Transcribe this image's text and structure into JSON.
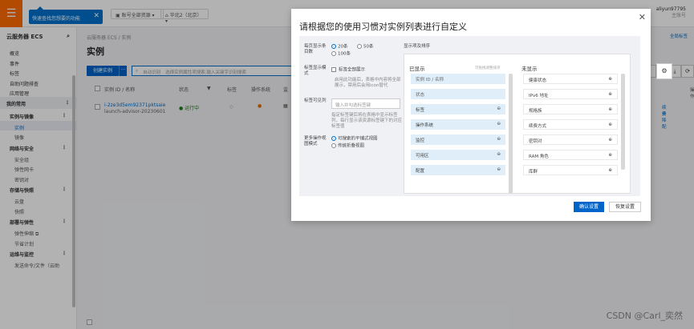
{
  "topbar": {
    "menu_icon": "hamburger-icon",
    "tip_text": "快速查找您想要的功能",
    "resource_group": "账号全部资源",
    "region": "华北2（北京）",
    "user_name": "aliyun97795",
    "user_sub": "主账号"
  },
  "sidebar": {
    "title": "云服务器 ECS",
    "items": [
      "概览",
      "事件",
      "标签",
      "自助问题排查",
      "应用管理"
    ],
    "fav_section": "我的常用",
    "instance_section": "实例与镜像",
    "instance_items": [
      "实例",
      "镜像"
    ],
    "network_section": "网络与安全",
    "network_items": [
      "安全组",
      "弹性网卡",
      "密钥对"
    ],
    "storage_section": "存储与快照",
    "storage_items": [
      "云盘",
      "快照"
    ],
    "deploy_section": "部署与弹性",
    "deploy_items": [
      "弹性伸缩",
      "节省计划"
    ],
    "ops_section": "运维与监控",
    "ops_items": [
      "发送命令/文件（云助"
    ]
  },
  "main": {
    "breadcrumb": "云服务器 ECS / 实例",
    "title": "实例",
    "create_button": "创建实例",
    "more_button": "···",
    "search_filter": "自动识别",
    "search_placeholder": "选择实例属性项搜索,输入关键字识别搜索",
    "columns": [
      "实例 ID / 名称",
      "状态",
      "标签",
      "操作系统",
      "监"
    ],
    "row": {
      "id": "i-2ze3d5em92371pktsaie",
      "name": "launch-advisor-20230601",
      "status": "运行中"
    },
    "right_cols": [
      "续费",
      "升降配"
    ],
    "right_col_header": "操作",
    "extra_link": "全局标签",
    "watermark": "CSDN @Carl_奕然"
  },
  "modal": {
    "title": "请根据您的使用习惯对实例列表进行自定义",
    "page_size_label": "每页显示条目数",
    "page_sizes": [
      "20条",
      "50条",
      "100条"
    ],
    "page_size_selected": "20条",
    "tag_mode_label": "标签显示模式",
    "tag_mode_option": "标签全部展示",
    "tag_mode_hint": "启用此功能后，表格中内容将全部展示，禁用后会用icon替代",
    "tag_column_label": "标签可见列",
    "tag_input_placeholder": "输入并勾选标签键",
    "tag_column_hint": "指定标签键后将在表格中显示标签列，每行显示该资源标签键下的对应标签值",
    "ops_mode_label": "更多操作视图模式",
    "ops_mode_options": [
      "可搜索的平铺式视图",
      "传统折叠视图"
    ],
    "ops_mode_selected": "可搜索的平铺式视图",
    "columns_label": "显示项及排序",
    "shown_label": "已显示",
    "shown_hint": "可拖拽调整排序",
    "hidden_label": "未显示",
    "shown_items": [
      "实例 ID / 名称",
      "状态",
      "标签",
      "操作系统",
      "监控",
      "可用区",
      "配置"
    ],
    "hidden_items": [
      "健康状态",
      "IPv6 地址",
      "规格族",
      "续费方式",
      "密钥对",
      "RAM 角色",
      "库群"
    ],
    "confirm_button": "确认设置",
    "reset_button": "恢复设置"
  }
}
